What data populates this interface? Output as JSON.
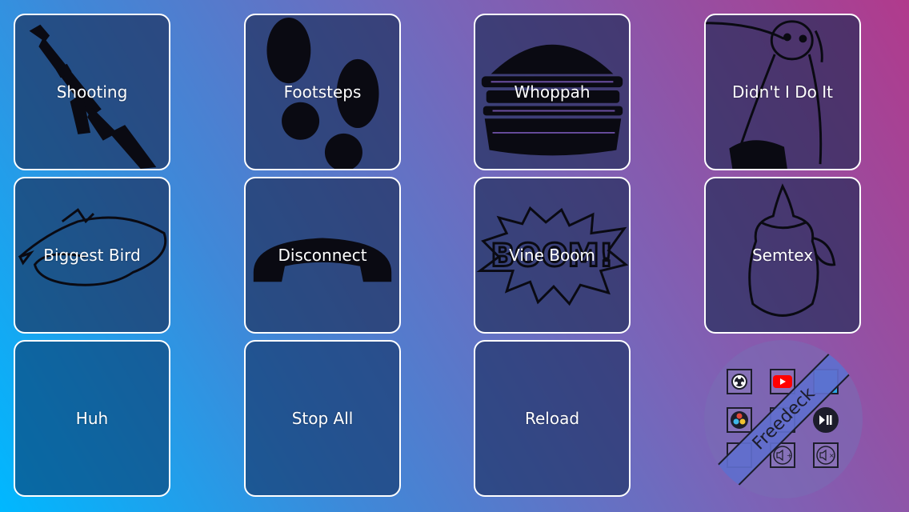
{
  "buttons": {
    "shooting": "Shooting",
    "footsteps": "Footsteps",
    "whoppah": "Whoppah",
    "didnt_i_do_it": "Didn't I Do It",
    "biggest_bird": "Biggest Bird",
    "disconnect": "Disconnect",
    "vine_boom": "Vine Boom",
    "semtex": "Semtex",
    "huh": "Huh",
    "stop_all": "Stop All",
    "reload": "Reload"
  },
  "logo": {
    "text": "Freedeck",
    "icons": [
      "obs-icon",
      "youtube-icon",
      "blue-app-icon",
      "davinci-resolve-icon",
      "play-pause-icon",
      "volume-up-icon",
      "mute-icon"
    ]
  },
  "colors": {
    "gradient_start": "#00b8ff",
    "gradient_end": "#b13a8c",
    "tile_border": "#ffffff",
    "label_text": "#ffffff"
  }
}
